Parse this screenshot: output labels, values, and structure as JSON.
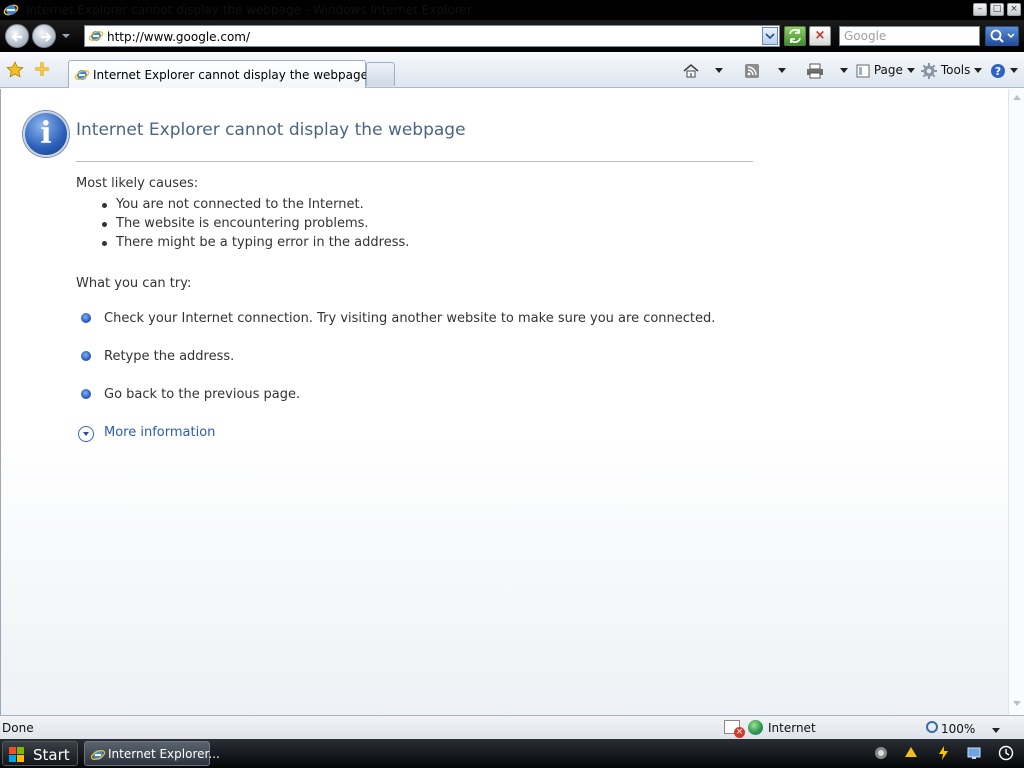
{
  "window": {
    "title": "Internet Explorer cannot display the webpage - Windows Internet Explorer",
    "minimize_glyph": "–",
    "maximize_glyph": "□",
    "close_glyph": "×"
  },
  "nav": {
    "url": "http://www.google.com/",
    "search_placeholder": "Google",
    "stop_glyph": "×"
  },
  "tabs": [
    {
      "label": "Internet Explorer cannot display the webpage",
      "active": true
    }
  ],
  "commands": {
    "page": "Page",
    "tools": "Tools"
  },
  "content": {
    "title": "Internet Explorer cannot display the webpage",
    "info_glyph": "i",
    "causes_label": "Most likely causes:",
    "causes": [
      "You are not connected to the Internet.",
      "The website is encountering problems.",
      "There might be a typing error in the address."
    ],
    "try_label": "What you can try:",
    "tries": [
      "Check your Internet connection. Try visiting another website to make sure you are connected.",
      "Retype the address.",
      "Go back to the previous page."
    ],
    "more_info": "More information"
  },
  "status": {
    "text": "Done",
    "zone": "Internet",
    "zoom": "100%"
  },
  "taskbar": {
    "start": "Start",
    "task_ie": "Internet Explorer..."
  },
  "colors": {
    "title_blue": "#4a6584",
    "link_blue": "#2a5db0"
  }
}
